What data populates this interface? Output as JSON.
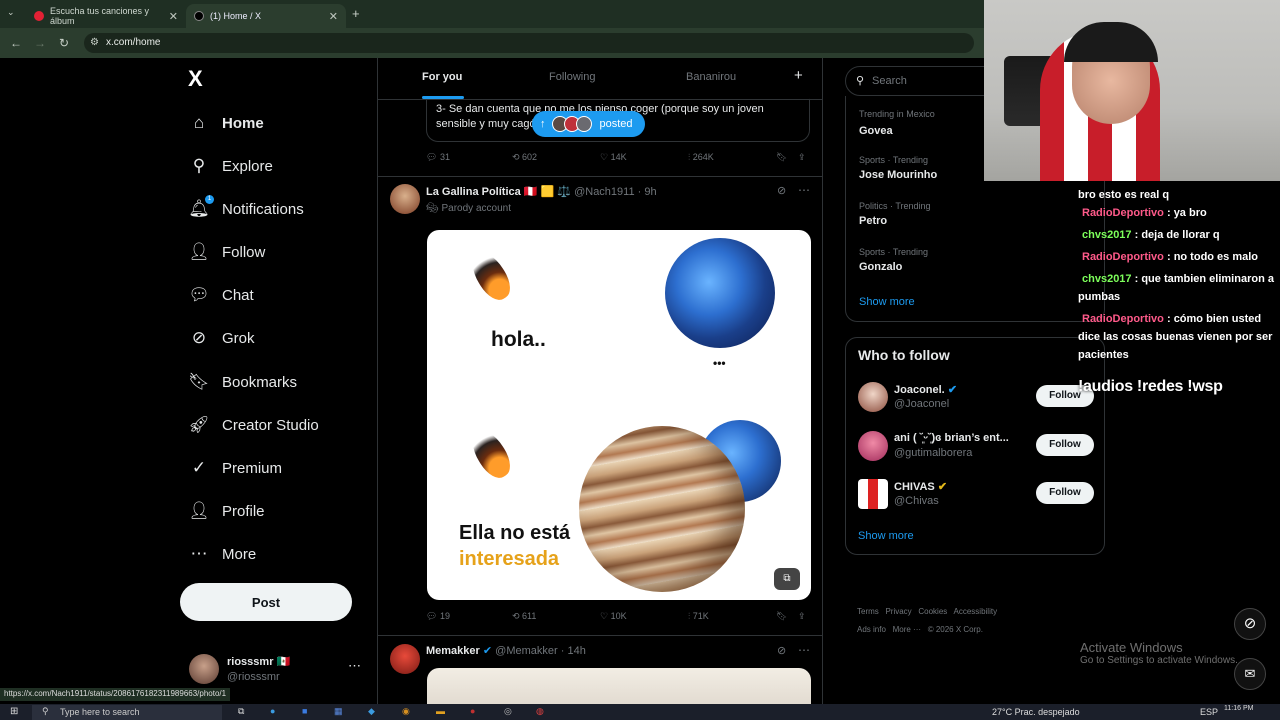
{
  "browser": {
    "tabs": [
      {
        "label": "Escucha tus canciones y álbum",
        "active": false
      },
      {
        "label": "(1) Home / X",
        "active": true
      }
    ],
    "new_tab": "+",
    "url": "x.com/home",
    "status_url": "https://x.com/Nach1911/status/2086176182311989663/photo/1"
  },
  "nav": {
    "logo": "X",
    "items": [
      {
        "label": "Home",
        "icon": "home-icon",
        "glyph": "⌂"
      },
      {
        "label": "Explore",
        "icon": "search-icon",
        "glyph": "⚲"
      },
      {
        "label": "Notifications",
        "icon": "bell-icon",
        "glyph": "🔔︎",
        "badge": "1"
      },
      {
        "label": "Follow",
        "icon": "follow-icon",
        "glyph": "👤︎"
      },
      {
        "label": "Chat",
        "icon": "chat-icon",
        "glyph": "💬︎"
      },
      {
        "label": "Grok",
        "icon": "grok-icon",
        "glyph": "⊘"
      },
      {
        "label": "Bookmarks",
        "icon": "bookmark-icon",
        "glyph": "🔖︎"
      },
      {
        "label": "Creator Studio",
        "icon": "rocket-icon",
        "glyph": "🚀︎"
      },
      {
        "label": "Premium",
        "icon": "verified-icon",
        "glyph": "✓"
      },
      {
        "label": "Profile",
        "icon": "profile-icon",
        "glyph": "👤︎"
      },
      {
        "label": "More",
        "icon": "more-icon",
        "glyph": "⋯"
      }
    ],
    "post_label": "Post",
    "account": {
      "name": "riosssmr 🇲🇽",
      "handle": "@riosssmr"
    }
  },
  "feed": {
    "tabs": [
      "For you",
      "Following",
      "Bananirou"
    ],
    "add_tab": "+",
    "new_posts_label": "posted",
    "prev_tweet": {
      "text": "3- Se dan cuenta que no me los pienso coger (porque soy un joven sensible y muy cagón)",
      "stats": {
        "replies": "31",
        "reposts": "602",
        "likes": "14K",
        "views": "264K"
      }
    },
    "tweet": {
      "name": "La Gallina Política 🇵🇪 🟨 ⚖️",
      "handle": "@Nach1911",
      "time": "9h",
      "label": "Parody account",
      "image_text": {
        "top": "hola..",
        "dots": "•••",
        "bottom_1": "Ella no está",
        "bottom_2": "interesada"
      },
      "stats": {
        "replies": "19",
        "reposts": "611",
        "likes": "10K",
        "views": "71K"
      }
    },
    "next_tweet": {
      "name": "Memakker",
      "handle": "@Memakker",
      "time": "14h"
    }
  },
  "right": {
    "search_placeholder": "Search",
    "trends": [
      {
        "category": "Trending in Mexico",
        "name": "Govea"
      },
      {
        "category": "Sports · Trending",
        "name": "Jose Mourinho"
      },
      {
        "category": "Politics · Trending",
        "name": "Petro"
      },
      {
        "category": "Sports · Trending",
        "name": "Gonzalo"
      }
    ],
    "show_more": "Show more",
    "who_to_follow_title": "Who to follow",
    "follow_suggestions": [
      {
        "name": "Joaconel.",
        "handle": "@Joaconel",
        "button": "Follow"
      },
      {
        "name": "ani ( ˘͈ᵕ˘͈)ɞ brian’s ent...",
        "handle": "@gutimalborera",
        "button": "Follow"
      },
      {
        "name": "CHIVAS",
        "handle": "@Chivas",
        "button": "Follow"
      }
    ],
    "footer": [
      "Terms",
      "Privacy",
      "Cookies",
      "Accessibility",
      "Ads info",
      "More ···",
      "© 2026 X Corp."
    ]
  },
  "chat": {
    "lines": [
      {
        "user": "",
        "text": "bro esto es real q"
      },
      {
        "user": "RadioDeportivo",
        "text": "ya bro",
        "color": "#ff5a8a"
      },
      {
        "user": "chvs2017",
        "text": "deja de llorar q",
        "color": "#7dff5b"
      },
      {
        "user": "RadioDeportivo",
        "text": "no todo es malo",
        "color": "#ff5a8a"
      },
      {
        "user": "chvs2017",
        "text": "que tambien eliminaron a pumbas",
        "color": "#7dff5b"
      },
      {
        "user": "RadioDeportivo",
        "text": "cómo bien usted dice las cosas buenas vienen por ser pacientes",
        "color": "#ff5a8a"
      }
    ],
    "commands": "!audios !redes !wsp"
  },
  "windows": {
    "activate_title": "Activate Windows",
    "activate_sub": "Go to Settings to activate Windows.",
    "search_placeholder": "Type here to search",
    "weather": "27°C Prac. despejado",
    "lang": "ESP",
    "time": "11:16 PM"
  }
}
